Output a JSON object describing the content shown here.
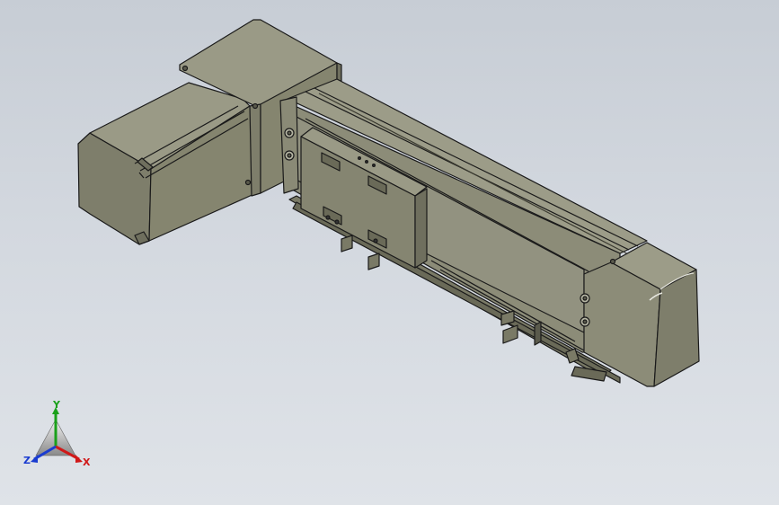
{
  "viewport": {
    "background_top": "#c7cdd5",
    "background_bottom": "#dfe3e8"
  },
  "model": {
    "body_color": "#8a8a76",
    "shadow_color": "#6f6f5e",
    "dark_color": "#5a5a4c",
    "edge_color": "#1a1a1a"
  },
  "triad": {
    "x_label": "X",
    "y_label": "Y",
    "z_label": "Z",
    "x_color": "#d01818",
    "y_color": "#1aa01a",
    "z_color": "#1a3cd0"
  }
}
